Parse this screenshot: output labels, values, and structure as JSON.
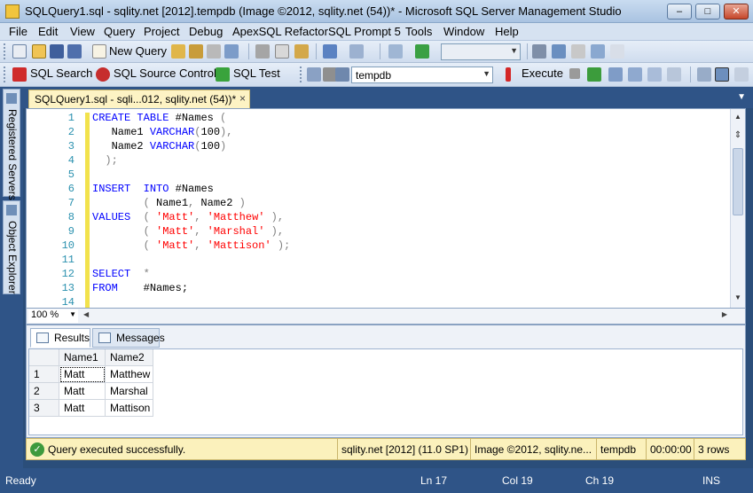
{
  "window": {
    "title": "SQLQuery1.sql - sqlity.net [2012].tempdb (Image ©2012, sqlity.net (54))* - Microsoft SQL Server Management Studio",
    "minimize": "–",
    "maximize": "□",
    "close": "✕"
  },
  "menu": [
    "File",
    "Edit",
    "View",
    "Query",
    "Project",
    "Debug",
    "ApexSQL Refactor",
    "SQL Prompt 5",
    "Tools",
    "Window",
    "Help"
  ],
  "toolbar1": {
    "new_query_label": "New Query"
  },
  "toolbar2": {
    "sql_search_label": "SQL Search",
    "sql_source_control_label": "SQL Source Control",
    "sql_test_label": "SQL Test",
    "database_selected": "tempdb",
    "execute_label": "Execute"
  },
  "left_dock": {
    "registered_servers": "Registered Servers",
    "object_explorer": "Object Explorer"
  },
  "document_tab": {
    "label": "SQLQuery1.sql - sqli...012, sqlity.net (54))*",
    "close": "×"
  },
  "editor": {
    "lines": [
      {
        "n": "1",
        "tokens": [
          {
            "t": "CREATE",
            "c": "kw"
          },
          {
            "t": " ",
            "c": "id"
          },
          {
            "t": "TABLE",
            "c": "kw"
          },
          {
            "t": " #Names ",
            "c": "id"
          },
          {
            "t": "(",
            "c": "op"
          }
        ]
      },
      {
        "n": "2",
        "tokens": [
          {
            "t": "   Name1 ",
            "c": "id"
          },
          {
            "t": "VARCHAR",
            "c": "kw"
          },
          {
            "t": "(",
            "c": "op"
          },
          {
            "t": "100",
            "c": "id"
          },
          {
            "t": "),",
            "c": "op"
          }
        ]
      },
      {
        "n": "3",
        "tokens": [
          {
            "t": "   Name2 ",
            "c": "id"
          },
          {
            "t": "VARCHAR",
            "c": "kw"
          },
          {
            "t": "(",
            "c": "op"
          },
          {
            "t": "100",
            "c": "id"
          },
          {
            "t": ")",
            "c": "op"
          }
        ]
      },
      {
        "n": "4",
        "tokens": [
          {
            "t": "  ",
            "c": "id"
          },
          {
            "t": ");",
            "c": "op"
          }
        ]
      },
      {
        "n": "5",
        "tokens": []
      },
      {
        "n": "6",
        "tokens": [
          {
            "t": "INSERT",
            "c": "kw"
          },
          {
            "t": "  ",
            "c": "id"
          },
          {
            "t": "INTO",
            "c": "kw"
          },
          {
            "t": " #Names",
            "c": "id"
          }
        ]
      },
      {
        "n": "7",
        "tokens": [
          {
            "t": "        ",
            "c": "id"
          },
          {
            "t": "(",
            "c": "op"
          },
          {
            "t": " Name1",
            "c": "id"
          },
          {
            "t": ",",
            "c": "op"
          },
          {
            "t": " Name2 ",
            "c": "id"
          },
          {
            "t": ")",
            "c": "op"
          }
        ]
      },
      {
        "n": "8",
        "tokens": [
          {
            "t": "VALUES",
            "c": "kw"
          },
          {
            "t": "  ",
            "c": "id"
          },
          {
            "t": "(",
            "c": "op"
          },
          {
            "t": " ",
            "c": "id"
          },
          {
            "t": "'Matt'",
            "c": "str"
          },
          {
            "t": ",",
            "c": "op"
          },
          {
            "t": " ",
            "c": "id"
          },
          {
            "t": "'Matthew'",
            "c": "str"
          },
          {
            "t": " ),",
            "c": "op"
          }
        ]
      },
      {
        "n": "9",
        "tokens": [
          {
            "t": "        ",
            "c": "id"
          },
          {
            "t": "(",
            "c": "op"
          },
          {
            "t": " ",
            "c": "id"
          },
          {
            "t": "'Matt'",
            "c": "str"
          },
          {
            "t": ",",
            "c": "op"
          },
          {
            "t": " ",
            "c": "id"
          },
          {
            "t": "'Marshal'",
            "c": "str"
          },
          {
            "t": " ),",
            "c": "op"
          }
        ]
      },
      {
        "n": "10",
        "tokens": [
          {
            "t": "        ",
            "c": "id"
          },
          {
            "t": "(",
            "c": "op"
          },
          {
            "t": " ",
            "c": "id"
          },
          {
            "t": "'Matt'",
            "c": "str"
          },
          {
            "t": ",",
            "c": "op"
          },
          {
            "t": " ",
            "c": "id"
          },
          {
            "t": "'Mattison'",
            "c": "str"
          },
          {
            "t": " );",
            "c": "op"
          }
        ]
      },
      {
        "n": "11",
        "tokens": []
      },
      {
        "n": "12",
        "tokens": [
          {
            "t": "SELECT",
            "c": "kw"
          },
          {
            "t": "  ",
            "c": "id"
          },
          {
            "t": "*",
            "c": "op"
          }
        ]
      },
      {
        "n": "13",
        "tokens": [
          {
            "t": "FROM",
            "c": "kw"
          },
          {
            "t": "    #Names;",
            "c": "id"
          }
        ]
      },
      {
        "n": "14",
        "tokens": []
      }
    ]
  },
  "zoom": "100 %",
  "results": {
    "tab_results": "Results",
    "tab_messages": "Messages",
    "columns": [
      "Name1",
      "Name2"
    ],
    "rows": [
      {
        "n": "1",
        "cells": [
          "Matt",
          "Matthew"
        ]
      },
      {
        "n": "2",
        "cells": [
          "Matt",
          "Marshal"
        ]
      },
      {
        "n": "3",
        "cells": [
          "Matt",
          "Mattison"
        ]
      }
    ]
  },
  "exec_status": {
    "message": "Query executed successfully.",
    "server": "sqlity.net [2012] (11.0 SP1)",
    "login": "Image ©2012, sqlity.ne...",
    "database": "tempdb",
    "elapsed": "00:00:00",
    "rows": "3 rows"
  },
  "statusbar": {
    "state": "Ready",
    "ln": "Ln 17",
    "col": "Col 19",
    "ch": "Ch 19",
    "mode": "INS"
  },
  "colors": {
    "chrome_blue": "#2f5487",
    "editor_keyword": "#0000ff",
    "editor_string": "#ff0000",
    "line_number": "#2b91af",
    "status_yellow": "#fbf1bc"
  }
}
